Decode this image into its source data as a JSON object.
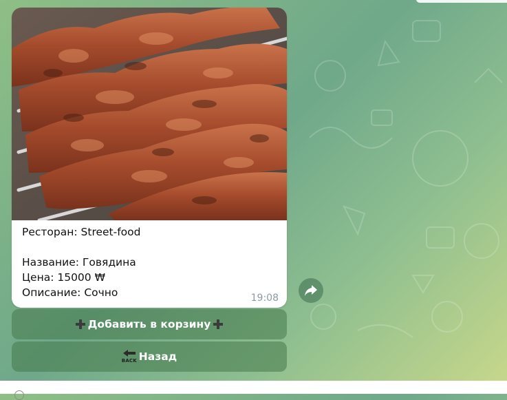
{
  "message": {
    "photo_alt": "Шашлык на мангале",
    "restaurant_label": "Ресторан: Street-food",
    "name_label": "Название: Говядина",
    "price_label": "Цена: 15000 ₩",
    "description_label": "Описание: Сочно",
    "time": "19:08"
  },
  "keyboard": {
    "add_to_cart_label": "Добавить в корзину",
    "back_label": "Назад",
    "back_icon_text": "BACK"
  },
  "icons": {
    "share": "share-arrow-icon",
    "plus": "plus-icon",
    "back": "back-arrow-icon",
    "attach": "attach-icon"
  },
  "colors": {
    "wallpaper": "#7fb38a",
    "message_bg": "#ffffff",
    "keyboard_button": "#5f946a",
    "timestamp": "#8a9aa5"
  }
}
